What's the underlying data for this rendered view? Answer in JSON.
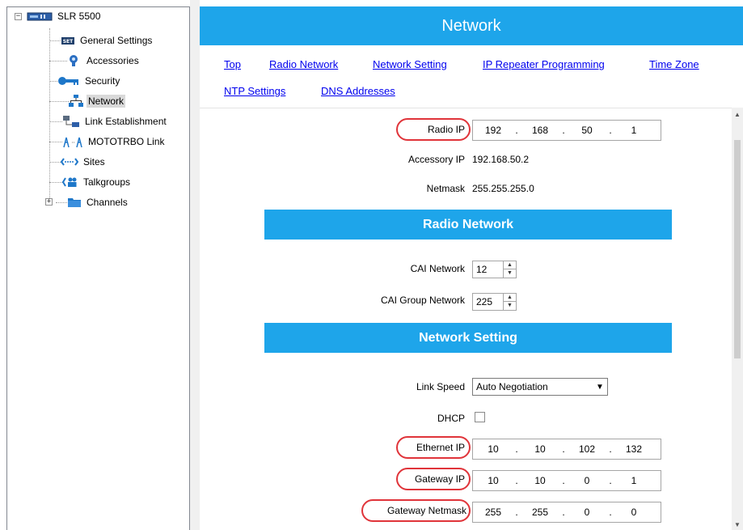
{
  "tree": {
    "root_label": "SLR 5500",
    "items": [
      {
        "label": "General Settings",
        "icon": "settings-icon"
      },
      {
        "label": "Accessories",
        "icon": "accessories-icon"
      },
      {
        "label": "Security",
        "icon": "key-icon"
      },
      {
        "label": "Network",
        "icon": "network-icon",
        "selected": true
      },
      {
        "label": "Link Establishment",
        "icon": "link-icon"
      },
      {
        "label": "MOTOTRBO Link",
        "icon": "mototrbo-link-icon"
      },
      {
        "label": "Sites",
        "icon": "sites-icon"
      },
      {
        "label": "Talkgroups",
        "icon": "talkgroups-icon"
      },
      {
        "label": "Channels",
        "icon": "folder-icon"
      }
    ]
  },
  "page": {
    "title": "Network",
    "nav_links": [
      "Top",
      "Radio Network",
      "Network Setting",
      "IP Repeater Programming",
      "Time Zone",
      "NTP Settings",
      "DNS Addresses"
    ]
  },
  "fields": {
    "radio_ip": {
      "label": "Radio IP",
      "octets": [
        "192",
        "168",
        "50",
        "1"
      ]
    },
    "accessory_ip": {
      "label": "Accessory IP",
      "value": "192.168.50.2"
    },
    "netmask": {
      "label": "Netmask",
      "value": "255.255.255.0"
    }
  },
  "radio_network": {
    "header": "Radio Network",
    "cai_network": {
      "label": "CAI Network",
      "value": "12"
    },
    "cai_group_network": {
      "label": "CAI Group Network",
      "value": "225"
    }
  },
  "network_setting": {
    "header": "Network Setting",
    "link_speed": {
      "label": "Link Speed",
      "value": "Auto Negotiation"
    },
    "dhcp": {
      "label": "DHCP",
      "checked": false
    },
    "ethernet_ip": {
      "label": "Ethernet IP",
      "octets": [
        "10",
        "10",
        "102",
        "132"
      ]
    },
    "gateway_ip": {
      "label": "Gateway IP",
      "octets": [
        "10",
        "10",
        "0",
        "1"
      ]
    },
    "gateway_netmask": {
      "label": "Gateway Netmask",
      "octets": [
        "255",
        "255",
        "0",
        "0"
      ]
    }
  },
  "colors": {
    "accent": "#1ea5ea",
    "highlight_ring": "#e0343a",
    "link": "#0000ee"
  }
}
